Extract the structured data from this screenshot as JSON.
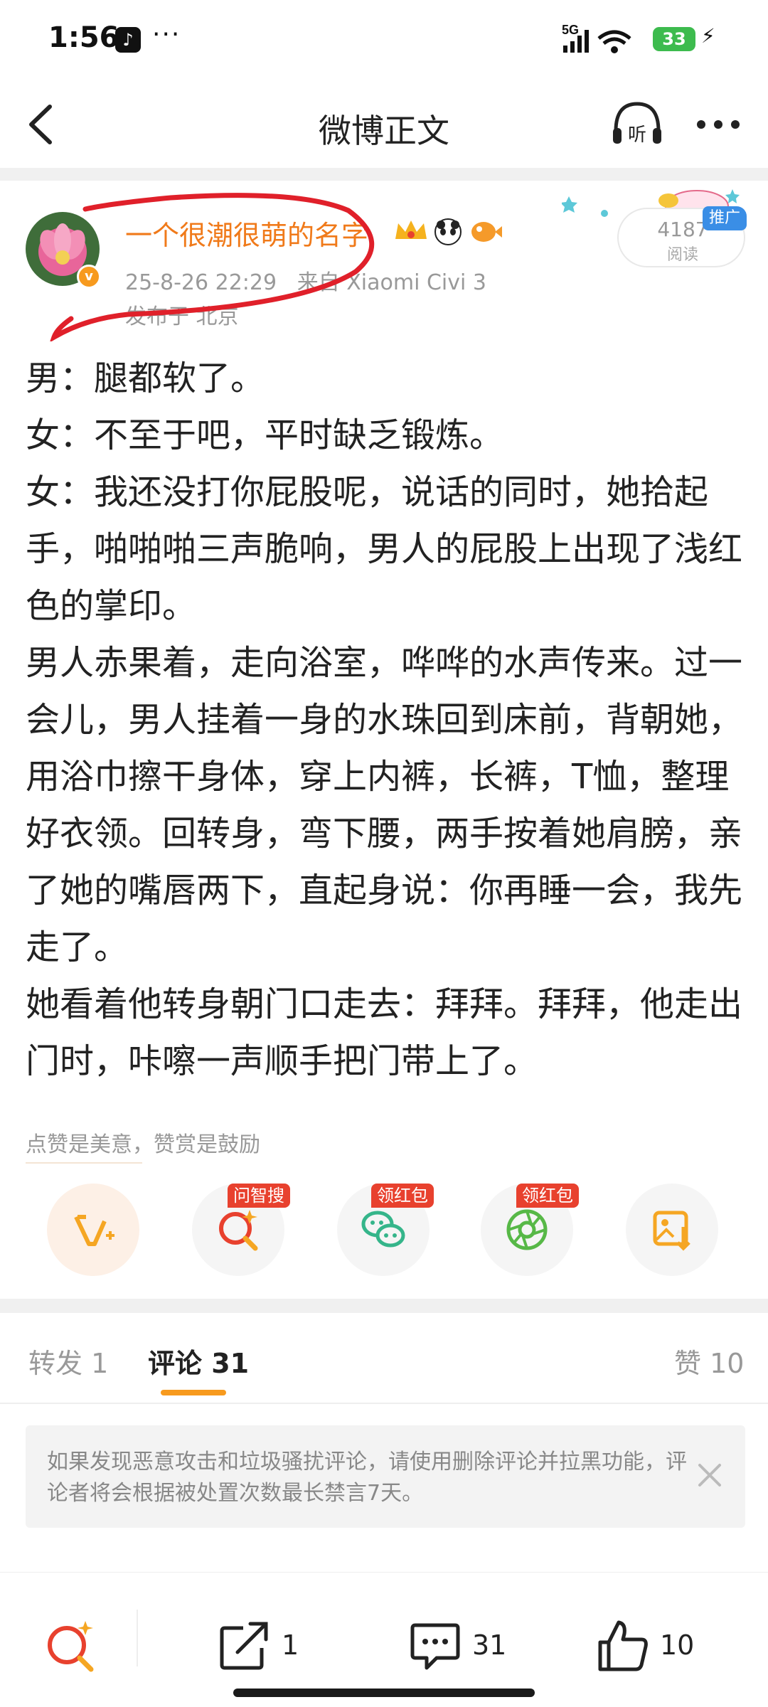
{
  "status_bar": {
    "time": "1:56",
    "more": "···",
    "network": "5G",
    "battery": "33"
  },
  "nav": {
    "title": "微博正文",
    "listen_label": "听"
  },
  "post": {
    "author": "一个很潮很萌的名字",
    "date": "25-8-26 22:29",
    "source": "来自 Xiaomi Civi 3",
    "location": "发布于 北京",
    "read_count": "4187",
    "read_label": "阅读",
    "promo_tag": "推广",
    "paragraphs": [
      "男：腿都软了。",
      "女：不至于吧，平时缺乏锻炼。",
      "女：我还没打你屁股呢，说话的同时，她拾起手，啪啪啪三声脆响，男人的屁股上出现了浅红色的掌印。",
      "男人赤果着，走向浴室，哗哗的水声传来。过一会儿，男人挂着一身的水珠回到床前，背朝她，用浴巾擦干身体，穿上内裤，长裤，T恤，整理好衣领。回转身，弯下腰，两手按着她肩膀，亲了她的嘴唇两下，直起身说：你再睡一会，我先走了。",
      "她看着他转身朝门口走去：拜拜。拜拜，他走出门时，咔嚓一声顺手把门带上了。"
    ],
    "reward_hint": "点赞是美意，赞赏是鼓励"
  },
  "actions": {
    "tag_search": "问智搜",
    "tag_redpack_1": "领红包",
    "tag_redpack_2": "领红包"
  },
  "tabs": {
    "repost": "转发 1",
    "comment": "评论 31",
    "like": "赞 10"
  },
  "notice": {
    "text": "如果发现恶意攻击和垃圾骚扰评论，请使用删除评论并拉黑功能，评论者将会根据被处置次数最长禁言7天。"
  },
  "bottom_bar": {
    "repost_count": "1",
    "comment_count": "31",
    "like_count": "10"
  },
  "colors": {
    "accent_orange": "#f79a1e",
    "author_orange": "#f07a1a",
    "tag_red": "#e8412e",
    "annotation_red": "#e0202a"
  }
}
